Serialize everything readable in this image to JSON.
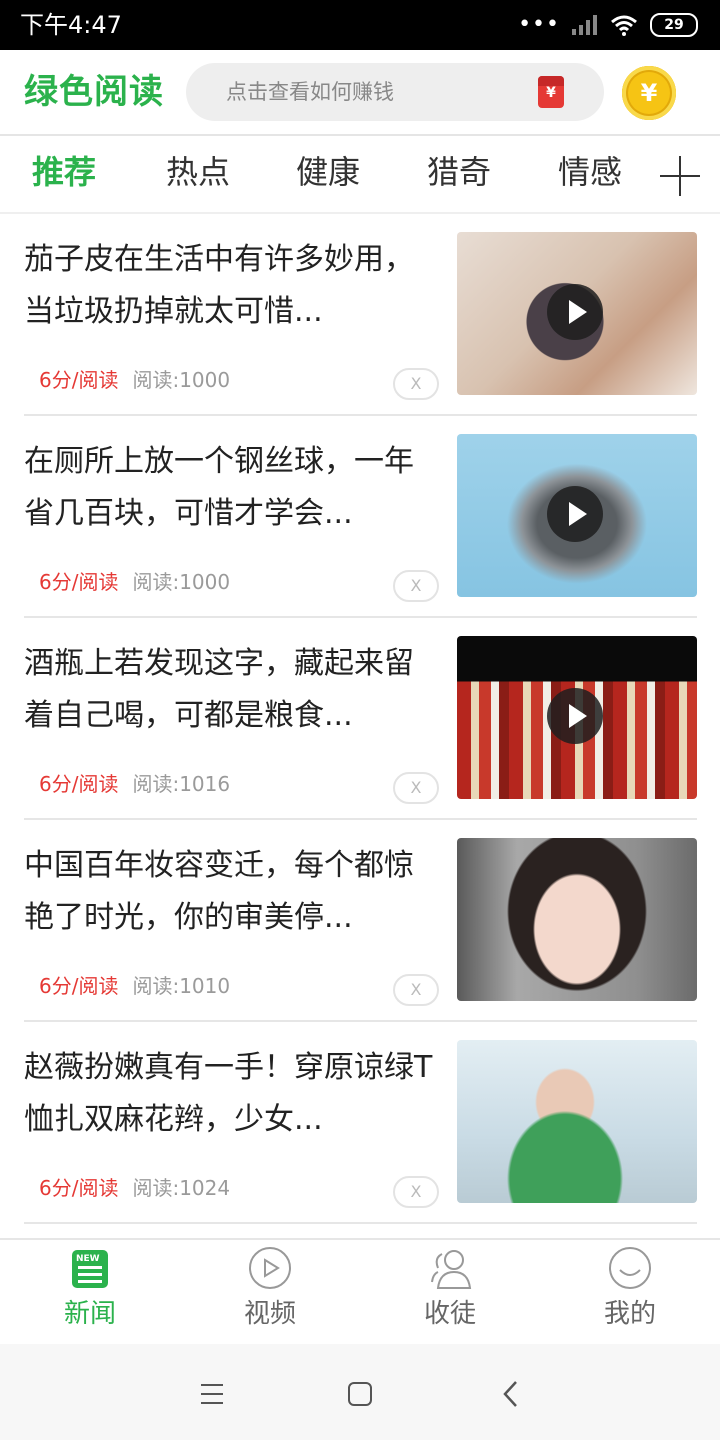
{
  "status_bar": {
    "time": "下午4:47",
    "battery": "29"
  },
  "header": {
    "app_title": "绿色阅读",
    "search_placeholder": "点击查看如何赚钱",
    "redpacket_icon": "red-envelope-icon",
    "coin_symbol": "¥"
  },
  "tabs": [
    {
      "label": "推荐",
      "active": true
    },
    {
      "label": "热点"
    },
    {
      "label": "健康"
    },
    {
      "label": "猎奇"
    },
    {
      "label": "情感"
    }
  ],
  "articles": [
    {
      "title": "茄子皮在生活中有许多妙用，当垃圾扔掉就太可惜...",
      "price": "6分/阅读",
      "reads": "阅读:1000",
      "close": "X",
      "thumb": "hands-eggplant-video"
    },
    {
      "title": "在厕所上放一个钢丝球，一年省几百块，可惜才学会...",
      "price": "6分/阅读",
      "reads": "阅读:1000",
      "close": "X",
      "thumb": "steel-wool-video"
    },
    {
      "title": "酒瓶上若发现这字，藏起来留着自己喝，可都是粮食...",
      "price": "6分/阅读",
      "reads": "阅读:1016",
      "close": "X",
      "thumb": "liquor-bottles-video"
    },
    {
      "title": "中国百年妆容变迁，每个都惊艳了时光，你的审美停...",
      "price": "6分/阅读",
      "reads": "阅读:1010",
      "close": "X",
      "thumb": "woman-portrait"
    },
    {
      "title": "赵薇扮嫩真有一手！穿原谅绿T恤扎双麻花辫，少女...",
      "price": "6分/阅读",
      "reads": "阅读:1024",
      "close": "X",
      "thumb": "airport-photo"
    }
  ],
  "bottom_nav": [
    {
      "label": "新闻",
      "icon": "news-icon",
      "active": true
    },
    {
      "label": "视频",
      "icon": "video-icon"
    },
    {
      "label": "收徒",
      "icon": "users-icon"
    },
    {
      "label": "我的",
      "icon": "smile-icon"
    }
  ],
  "colors": {
    "brand_green": "#2bb24c",
    "price_red": "#e53935"
  },
  "nav_badge": "NEW"
}
